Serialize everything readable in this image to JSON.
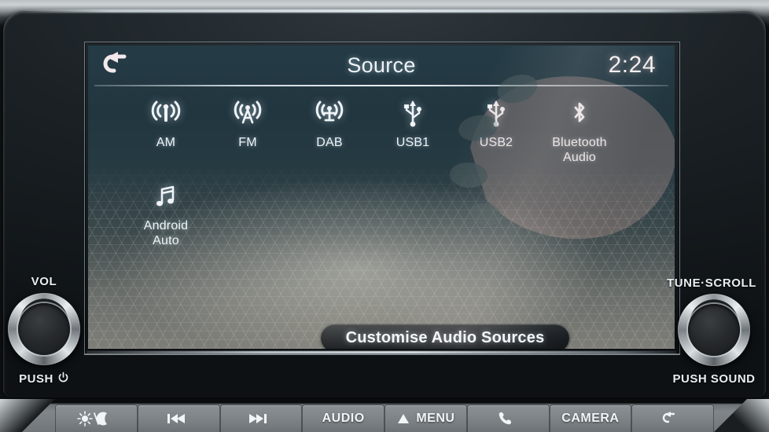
{
  "screen": {
    "header": {
      "back_icon": "back-arrow-icon",
      "title": "Source",
      "clock": "2:24"
    },
    "sources": [
      {
        "id": "am",
        "label": "AM",
        "icon": "radio-antenna-icon"
      },
      {
        "id": "fm",
        "label": "FM",
        "icon": "radio-tower-icon"
      },
      {
        "id": "dab",
        "label": "DAB",
        "icon": "dab-satellite-icon"
      },
      {
        "id": "usb1",
        "label": "USB1",
        "icon": "usb-icon"
      },
      {
        "id": "usb2",
        "label": "USB2",
        "icon": "usb-icon"
      },
      {
        "id": "bluetooth-audio",
        "label": "Bluetooth\nAudio",
        "icon": "bluetooth-icon"
      },
      {
        "id": "android-auto",
        "label": "Android\nAuto",
        "icon": "music-note-icon"
      }
    ],
    "customise_button": {
      "label": "Customise Audio Sources"
    }
  },
  "controls": {
    "left_knob": {
      "label": "VOL",
      "sub_label": "PUSH",
      "sub_icon": "power-icon"
    },
    "right_knob": {
      "label": "TUNE·SCROLL",
      "sub_label": "PUSH SOUND"
    }
  },
  "button_bar": [
    {
      "id": "brightness",
      "label": "",
      "icon": "sun-moon-icon"
    },
    {
      "id": "prev-track",
      "label": "",
      "icon": "skip-back-icon"
    },
    {
      "id": "next-track",
      "label": "",
      "icon": "skip-forward-icon"
    },
    {
      "id": "audio",
      "label": "AUDIO",
      "icon": ""
    },
    {
      "id": "menu",
      "label": "MENU",
      "icon": "menu-triangle-icon"
    },
    {
      "id": "phone",
      "label": "",
      "icon": "phone-icon"
    },
    {
      "id": "camera",
      "label": "CAMERA",
      "icon": ""
    },
    {
      "id": "back",
      "label": "",
      "icon": "back-arrow-icon"
    }
  ],
  "colors": {
    "screen_top": "#243b46",
    "screen_bottom": "#7e7e78",
    "text": "#f0f4f7",
    "bezel": "#16191c",
    "button_bar": "#80868a"
  }
}
